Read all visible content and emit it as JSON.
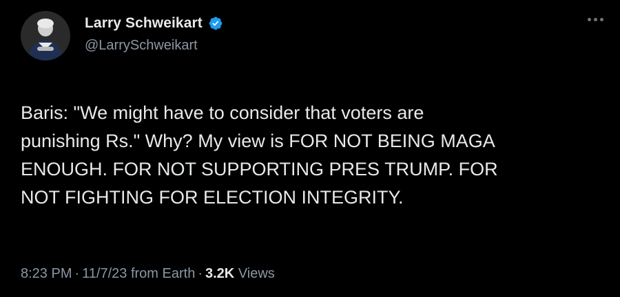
{
  "author": {
    "display_name": "Larry Schweikart",
    "handle": "@LarrySchweikart",
    "verified": true,
    "verified_color": "#1d9bf0"
  },
  "tweet": {
    "text": "Baris: \"We might have to consider that voters are\npunishing Rs.\" Why? My view is FOR NOT BEING MAGA\nENOUGH. FOR NOT SUPPORTING PRES TRUMP. FOR\nNOT FIGHTING FOR ELECTION INTEGRITY."
  },
  "meta": {
    "time": "8:23 PM",
    "separator": "·",
    "date": "11/7/23",
    "source": "from Earth",
    "views_count": "3.2K",
    "views_label": "Views"
  },
  "icons": {
    "more": "more-horizontal-icon",
    "verified": "verified-badge-icon",
    "avatar": "profile-avatar"
  },
  "colors": {
    "background": "#000000",
    "primary_text": "#e7e9ea",
    "secondary_text": "#8b98a5"
  }
}
